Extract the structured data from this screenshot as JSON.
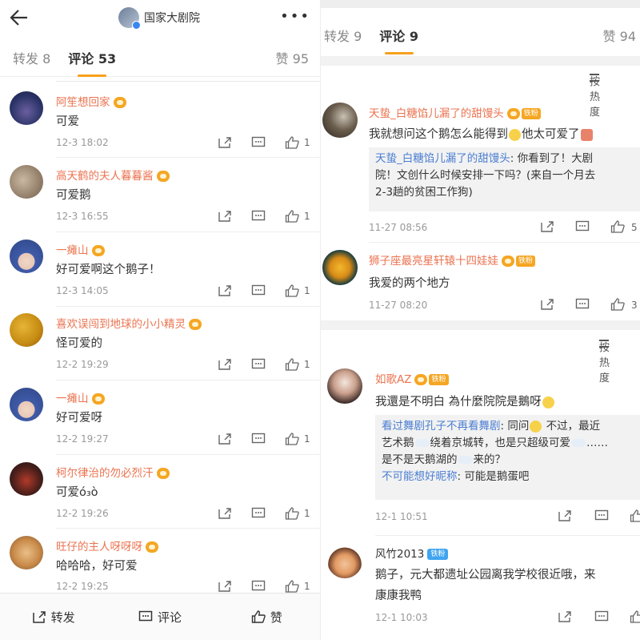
{
  "left": {
    "header": {
      "account_name": "国家大剧院"
    },
    "tabs": [
      {
        "label": "转发 8"
      },
      {
        "label": "评论 53"
      },
      {
        "label": "赞 95"
      }
    ],
    "comments": [
      {
        "name": "阿笙想回家",
        "text": "可爱",
        "time": "12-3 18:02",
        "likes": "1"
      },
      {
        "name": "高天鹤的夫人暮暮酱",
        "text": "可爱鹅",
        "time": "12-3 16:55",
        "likes": "1"
      },
      {
        "name": "一瘫山",
        "text": "好可爱啊这个鹅子！",
        "time": "12-3 14:05",
        "likes": "1"
      },
      {
        "name": "喜欢误闯到地球的小小精灵",
        "text": "怪可爱的",
        "time": "12-2 19:29",
        "likes": "1"
      },
      {
        "name": "一瘫山",
        "text": "好可爱呀",
        "time": "12-2 19:27",
        "likes": "1"
      },
      {
        "name": "柯尔律治的勿必烈汗",
        "text": "可爱ό₃ὸ",
        "time": "12-2 19:26",
        "likes": "1"
      },
      {
        "name": "旺仔的主人呀呀呀",
        "text": "哈哈哈，好可爱",
        "time": "12-2 19:25",
        "likes": "1"
      }
    ],
    "bottom": {
      "repost": "转发",
      "comment": "评论",
      "like": "赞"
    }
  },
  "right": {
    "tabs": [
      {
        "label": "转发 9"
      },
      {
        "label": "评论 9"
      },
      {
        "label": "赞 94"
      }
    ],
    "sort_label": "按热度",
    "comments": [
      {
        "name": "天蛰_白糖馅儿漏了的甜馒头",
        "fan": "铁粉",
        "text": "我就想问这个鹅怎么能得到",
        "text2": "他太可爱了",
        "time": "11-27 08:56",
        "likes": "5",
        "reply": {
          "name": "天蛰_白糖馅儿漏了的甜馒头",
          "line1": ": 你看到了！大剧",
          "line2": "院！文创什么时候安排一下吗？(来自一个月去",
          "line3": "2-3趟的贫困工作狗)"
        }
      },
      {
        "name": "狮子座最亮星轩辕十四娃娃",
        "fan": "铁粉",
        "text": "我爱的两个地方",
        "time": "11-27 08:20",
        "likes": "3"
      },
      {
        "name": "如歌AZ",
        "fan": "铁粉",
        "text": "我還是不明白 為什麼院院是鵝呀",
        "time": "12-1 10:51",
        "likes": "",
        "reply": {
          "name": "看过舞剧孔子不再看舞剧",
          "line1": ": 同问",
          "line1b": " 不过，最近",
          "line2": "艺术鹅",
          "line2b": "绕着京城转，也是只超级可爱",
          "line2c": "……",
          "line3": "是不是天鹅湖的",
          "line3b": "来的？",
          "name2": "不可能想好昵称",
          "line4": ": 可能是鹅蛋吧"
        }
      },
      {
        "name": "风竹2013",
        "fan": "铁粉",
        "text": "鹅子，元大都遗址公园离我学校很近哦，来",
        "text2": "康康我鸭",
        "time": "12-1 10:03",
        "likes": ""
      }
    ]
  },
  "colors": {
    "username": "#eb7350",
    "accent": "#f7a01c",
    "link": "#4a7ed1"
  }
}
